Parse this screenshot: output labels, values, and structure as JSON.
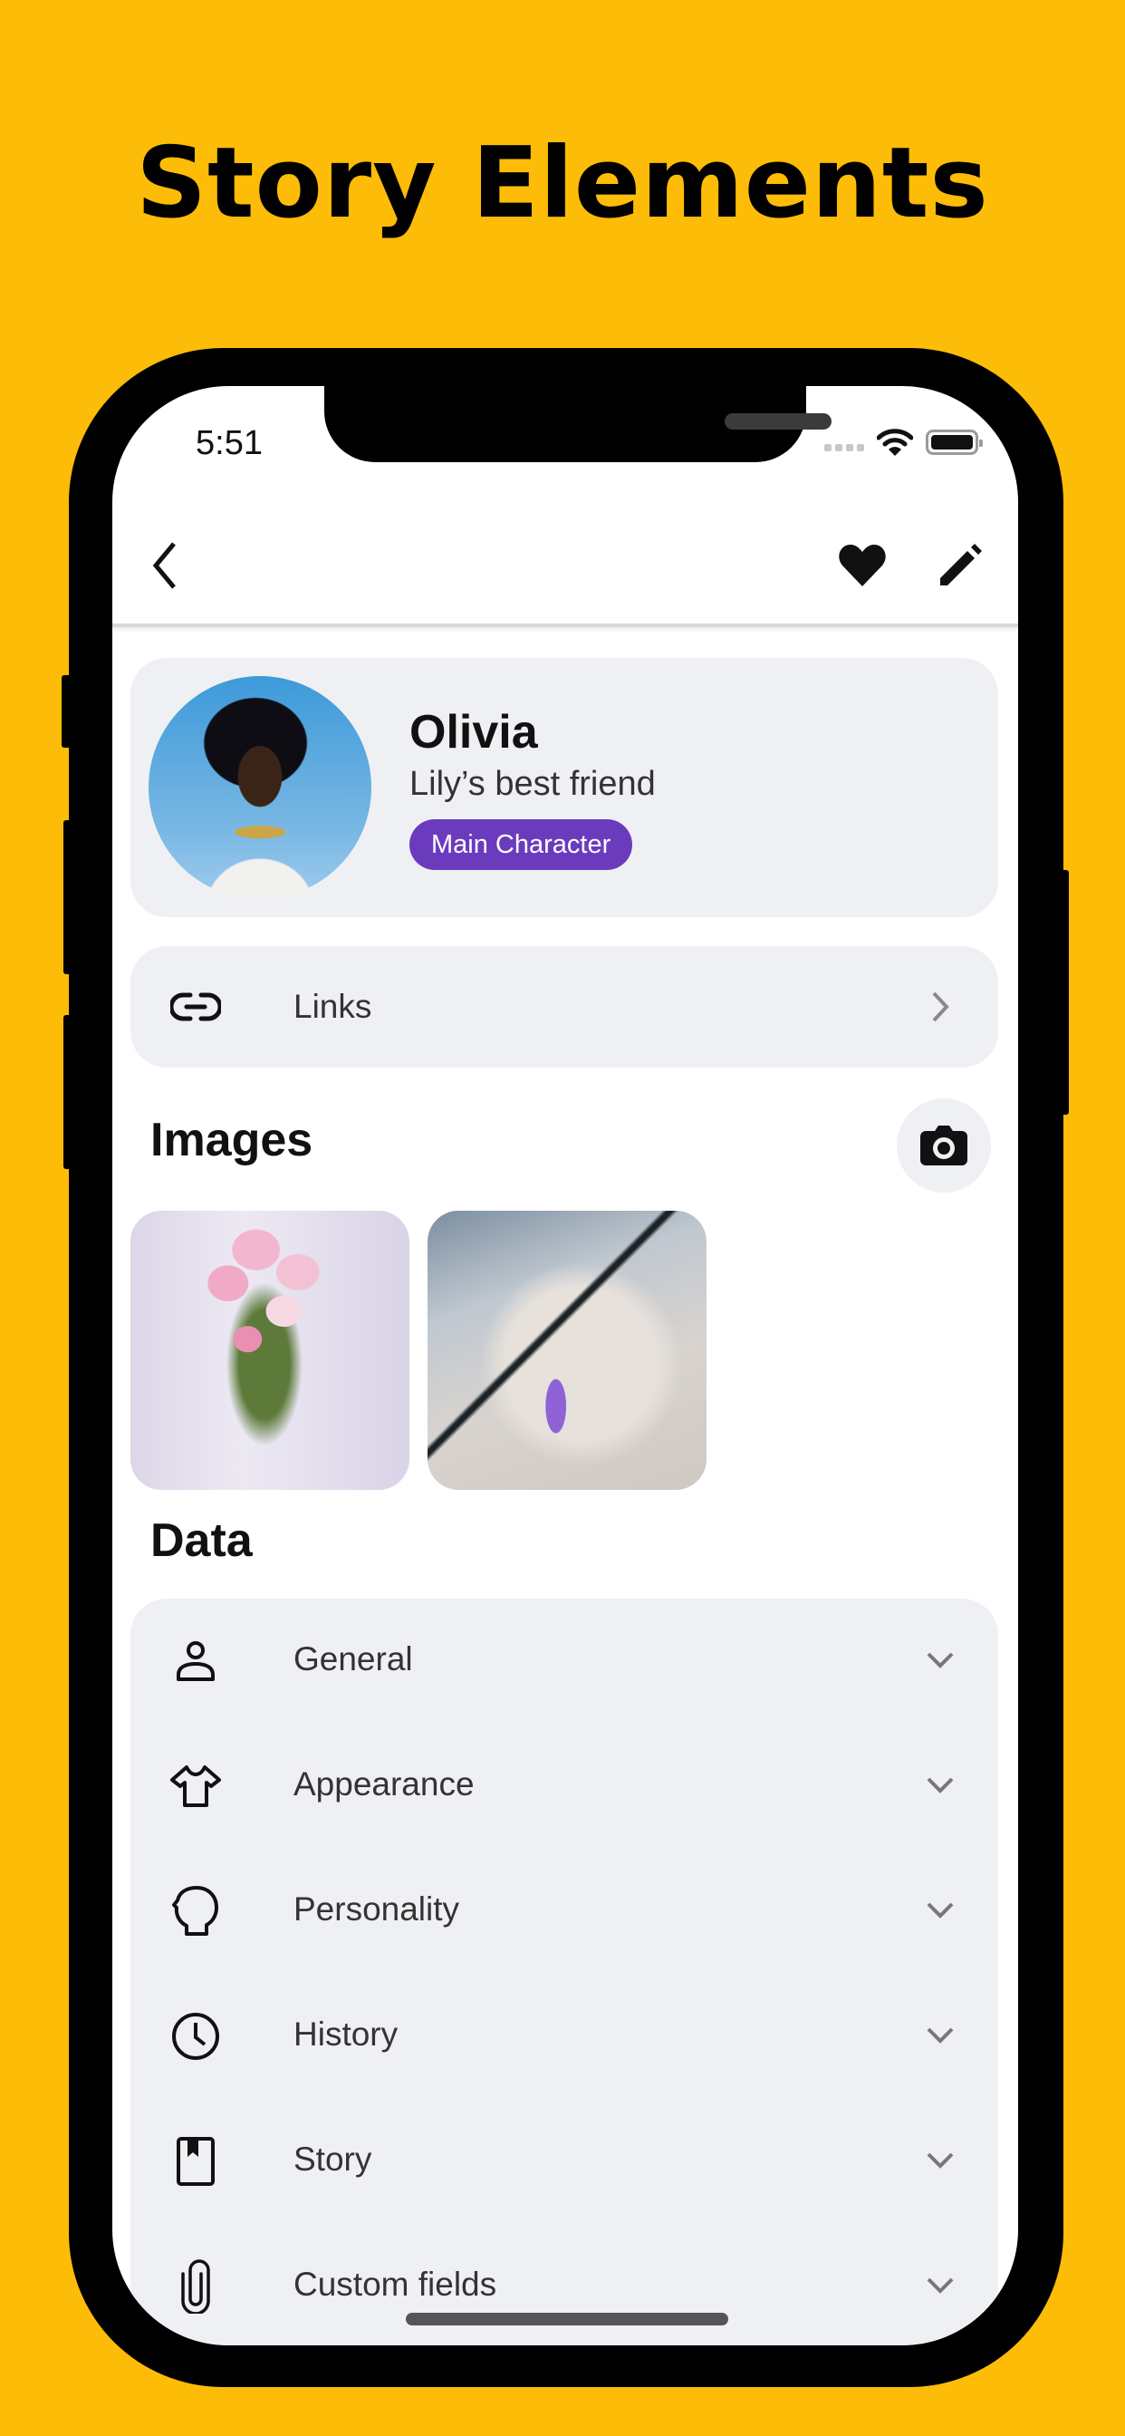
{
  "promo": {
    "title": "Story Elements"
  },
  "colors": {
    "background": "#FDBC07",
    "accent_badge": "#6B3BBE",
    "card": "#EFF0F3"
  },
  "status_bar": {
    "time": "5:51",
    "icons": [
      "cellular-signal-icon",
      "wifi-icon",
      "battery-icon"
    ]
  },
  "navbar": {
    "back_icon": "chevron-left-icon",
    "favorite_icon": "heart-icon",
    "edit_icon": "pencil-icon"
  },
  "profile": {
    "name": "Olivia",
    "subtitle": "Lily’s best friend",
    "badge": "Main Character",
    "avatar": "portrait-photo"
  },
  "links": {
    "label": "Links",
    "icon": "link-icon",
    "trailing_icon": "chevron-right-icon"
  },
  "images": {
    "title": "Images",
    "add_icon": "camera-icon",
    "items": [
      {
        "alt": "Bridal bouquet of pink flowers"
      },
      {
        "alt": "Amethyst crystal pendant necklace"
      }
    ]
  },
  "data_section": {
    "title": "Data",
    "items": [
      {
        "label": "General",
        "icon": "person-icon"
      },
      {
        "label": "Appearance",
        "icon": "tshirt-icon"
      },
      {
        "label": "Personality",
        "icon": "head-profile-icon"
      },
      {
        "label": "History",
        "icon": "clock-icon"
      },
      {
        "label": "Story",
        "icon": "book-bookmark-icon"
      },
      {
        "label": "Custom fields",
        "icon": "paperclip-icon"
      }
    ],
    "trailing_icon": "chevron-down-icon"
  }
}
